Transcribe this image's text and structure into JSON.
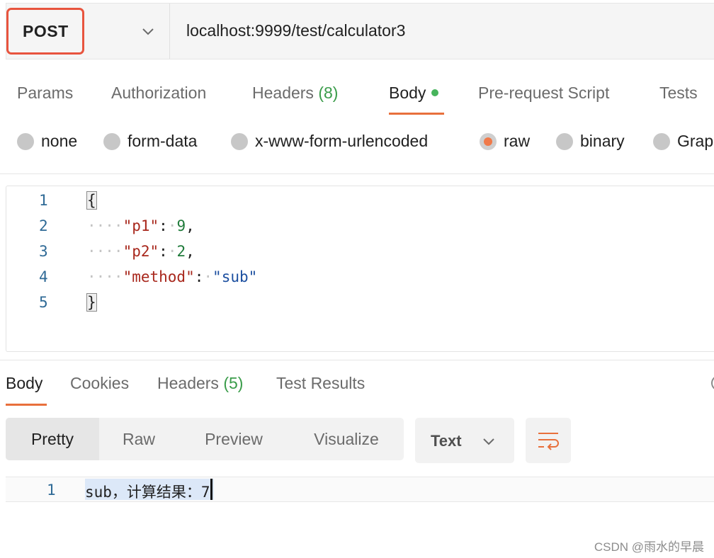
{
  "request": {
    "method": "POST",
    "url": "localhost:9999/test/calculator3"
  },
  "request_tabs": [
    {
      "label": "Params"
    },
    {
      "label": "Authorization"
    },
    {
      "label": "Headers",
      "count": "(8)"
    },
    {
      "label": "Body",
      "active": true,
      "indicator": "green-dot"
    },
    {
      "label": "Pre-request Script"
    },
    {
      "label": "Tests"
    }
  ],
  "body_types": [
    {
      "label": "none"
    },
    {
      "label": "form-data"
    },
    {
      "label": "x-www-form-urlencoded"
    },
    {
      "label": "raw",
      "selected": true
    },
    {
      "label": "binary"
    },
    {
      "label": "Grap"
    }
  ],
  "editor": {
    "lines": [
      {
        "num": "1",
        "text": "{"
      },
      {
        "num": "2",
        "key": "\"p1\"",
        "value": "9"
      },
      {
        "num": "3",
        "key": "\"p2\"",
        "value": "2"
      },
      {
        "num": "4",
        "key": "\"method\"",
        "value": "\"sub\""
      },
      {
        "num": "5",
        "text": "}"
      }
    ]
  },
  "response_tabs": [
    {
      "label": "Body",
      "active": true
    },
    {
      "label": "Cookies"
    },
    {
      "label": "Headers",
      "count": "(5)"
    },
    {
      "label": "Test Results"
    }
  ],
  "view_modes": [
    "Pretty",
    "Raw",
    "Preview",
    "Visualize"
  ],
  "active_view_mode": "Pretty",
  "format": "Text",
  "response": {
    "line_num": "1",
    "text": "sub，计算结果：7"
  },
  "watermark": "CSDN @雨水的早晨",
  "colors": {
    "accent": "#e8703c",
    "method_highlight": "#e8543e",
    "count_green": "#3a9c4a",
    "line_number": "#2f6a96",
    "json_key": "#a8271c",
    "json_number": "#1f7a3a",
    "json_string": "#1c4fa0"
  },
  "icons": {
    "method_dropdown": "chevron-down-icon",
    "format_dropdown": "chevron-down-icon",
    "wrap": "wrap-lines-icon",
    "history": "clock-icon"
  }
}
